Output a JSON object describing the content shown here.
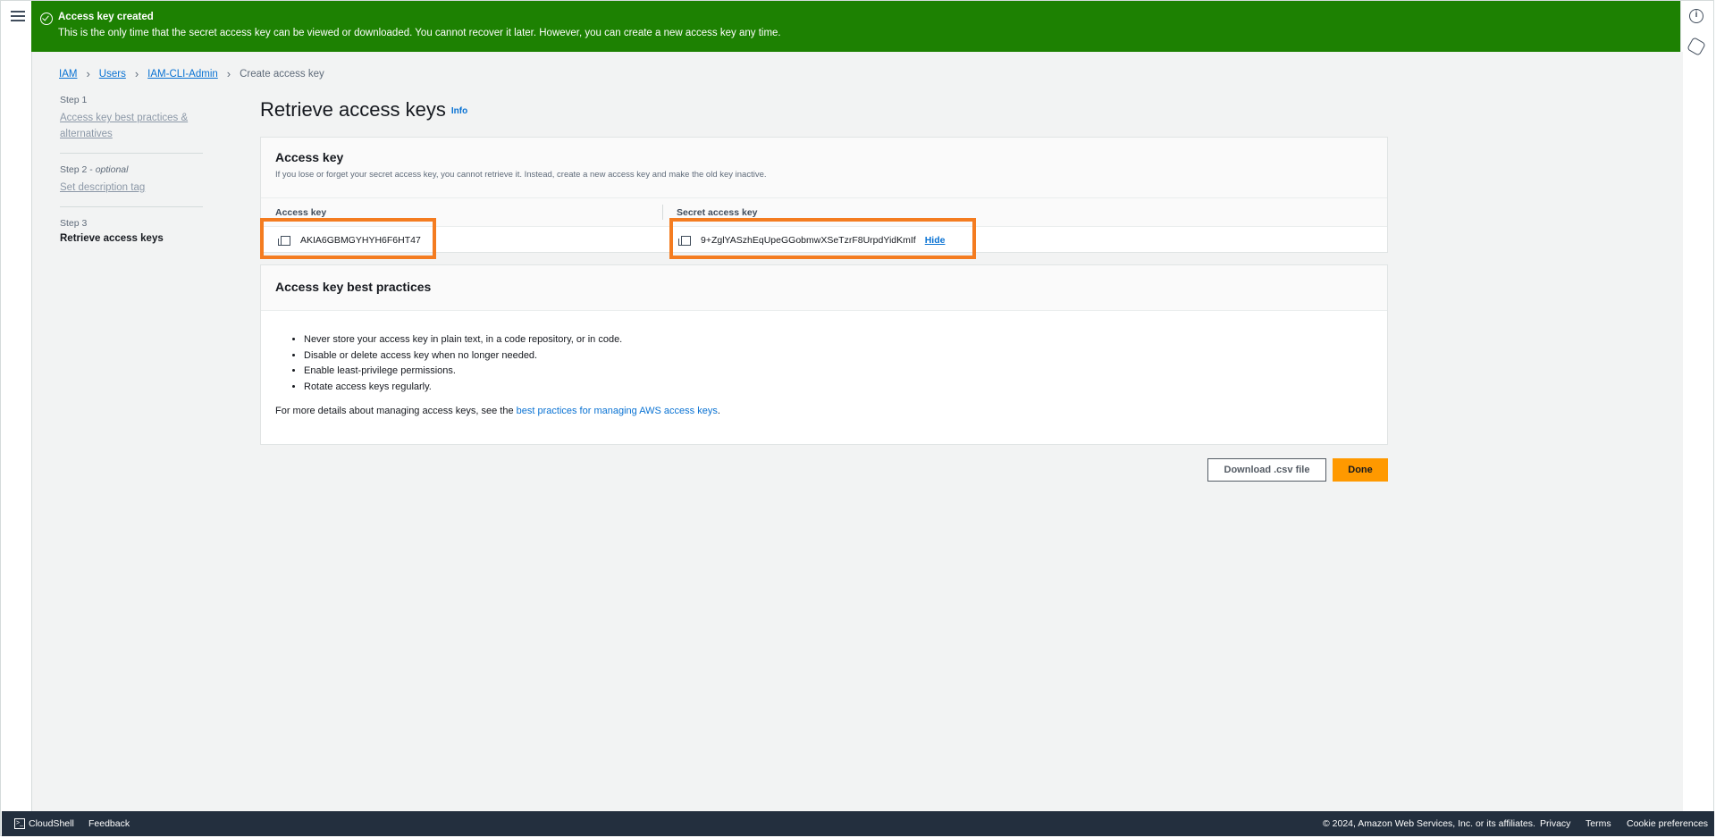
{
  "flash": {
    "title": "Access key created",
    "message": "This is the only time that the secret access key can be viewed or downloaded. You cannot recover it later. However, you can create a new access key any time."
  },
  "breadcrumb": {
    "items": [
      "IAM",
      "Users",
      "IAM-CLI-Admin"
    ],
    "current": "Create access key"
  },
  "steps": [
    {
      "num": "Step 1",
      "label": "Access key best practices & alternatives"
    },
    {
      "num": "Step 2",
      "optional": "optional",
      "label": "Set description tag"
    },
    {
      "num": "Step 3",
      "label": "Retrieve access keys"
    }
  ],
  "page": {
    "title": "Retrieve access keys",
    "info": "Info"
  },
  "access_key_panel": {
    "title": "Access key",
    "description": "If you lose or forget your secret access key, you cannot retrieve it. Instead, create a new access key and make the old key inactive.",
    "col_access_key": "Access key",
    "col_secret_key": "Secret access key",
    "access_key_value": "AKIA6GBMGYHYH6F6HT47",
    "secret_key_value": "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",
    "hide_label": "Hide"
  },
  "best_practices": {
    "title": "Access key best practices",
    "items": [
      "Never store your access key in plain text, in a code repository, or in code.",
      "Disable or delete access key when no longer needed.",
      "Enable least-privilege permissions.",
      "Rotate access keys regularly."
    ],
    "more_prefix": "For more details about managing access keys, see the ",
    "more_link": "best practices for managing AWS access keys",
    "more_suffix": "."
  },
  "actions": {
    "download": "Download .csv file",
    "done": "Done"
  },
  "footer": {
    "cloudshell": "CloudShell",
    "feedback": "Feedback",
    "copyright": "© 2024, Amazon Web Services, Inc. or its affiliates.",
    "privacy": "Privacy",
    "terms": "Terms",
    "cookies": "Cookie preferences"
  },
  "colors": {
    "success": "#1d8102",
    "link": "#0972d3",
    "primary": "#ff9900",
    "highlight": "#f47c20",
    "footer_bg": "#232f3e"
  },
  "icons": [
    "menu-icon",
    "info-circle-icon",
    "settings-hex-icon",
    "success-check-icon",
    "copy-icon",
    "cloudshell-icon",
    "chevron-right-icon"
  ]
}
